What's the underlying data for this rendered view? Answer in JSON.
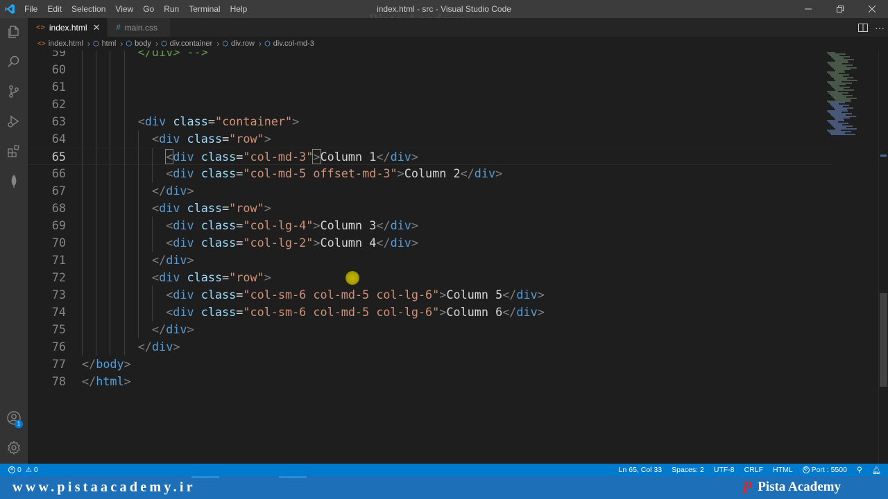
{
  "window": {
    "title": "index.html - src - Visual Studio Code",
    "watermark": "Pista Academy"
  },
  "menu": [
    "File",
    "Edit",
    "Selection",
    "View",
    "Go",
    "Run",
    "Terminal",
    "Help"
  ],
  "tabs": [
    {
      "label": "index.html",
      "icon": "html-file-icon",
      "active": true
    },
    {
      "label": "main.css",
      "icon": "css-file-icon",
      "active": false
    }
  ],
  "breadcrumb": [
    "index.html",
    "html",
    "body",
    "div.container",
    "div.row",
    "div.col-md-3"
  ],
  "editor": {
    "current_line": "65",
    "lines": [
      {
        "n": "59",
        "tokens": [
          [
            "c",
            "</div> -->"
          ]
        ],
        "indent": 4
      },
      {
        "n": "60",
        "tokens": [],
        "indent": 0
      },
      {
        "n": "61",
        "tokens": [],
        "indent": 0
      },
      {
        "n": "62",
        "tokens": [],
        "indent": 0
      },
      {
        "n": "63",
        "tokens": [
          [
            "b",
            "<"
          ],
          [
            "t",
            "div"
          ],
          [
            "x",
            " "
          ],
          [
            "a",
            "class"
          ],
          [
            "x",
            "="
          ],
          [
            "s",
            "\"container\""
          ],
          [
            "b",
            ">"
          ]
        ],
        "indent": 4
      },
      {
        "n": "64",
        "tokens": [
          [
            "b",
            "<"
          ],
          [
            "t",
            "div"
          ],
          [
            "x",
            " "
          ],
          [
            "a",
            "class"
          ],
          [
            "x",
            "="
          ],
          [
            "s",
            "\"row\""
          ],
          [
            "b",
            ">"
          ]
        ],
        "indent": 5
      },
      {
        "n": "65",
        "tokens": [
          [
            "b",
            "<"
          ],
          [
            "t",
            "div"
          ],
          [
            "x",
            " "
          ],
          [
            "a",
            "class"
          ],
          [
            "x",
            "="
          ],
          [
            "s",
            "\"col-md-3\""
          ],
          [
            "b",
            ">"
          ],
          [
            "x",
            "Column 1"
          ],
          [
            "b",
            "</"
          ],
          [
            "t",
            "div"
          ],
          [
            "b",
            ">"
          ]
        ],
        "indent": 6
      },
      {
        "n": "66",
        "tokens": [
          [
            "b",
            "<"
          ],
          [
            "t",
            "div"
          ],
          [
            "x",
            " "
          ],
          [
            "a",
            "class"
          ],
          [
            "x",
            "="
          ],
          [
            "s",
            "\"col-md-5 offset-md-3\""
          ],
          [
            "b",
            ">"
          ],
          [
            "x",
            "Column 2"
          ],
          [
            "b",
            "</"
          ],
          [
            "t",
            "div"
          ],
          [
            "b",
            ">"
          ]
        ],
        "indent": 6
      },
      {
        "n": "67",
        "tokens": [
          [
            "b",
            "</"
          ],
          [
            "t",
            "div"
          ],
          [
            "b",
            ">"
          ]
        ],
        "indent": 5
      },
      {
        "n": "68",
        "tokens": [
          [
            "b",
            "<"
          ],
          [
            "t",
            "div"
          ],
          [
            "x",
            " "
          ],
          [
            "a",
            "class"
          ],
          [
            "x",
            "="
          ],
          [
            "s",
            "\"row\""
          ],
          [
            "b",
            ">"
          ]
        ],
        "indent": 5
      },
      {
        "n": "69",
        "tokens": [
          [
            "b",
            "<"
          ],
          [
            "t",
            "div"
          ],
          [
            "x",
            " "
          ],
          [
            "a",
            "class"
          ],
          [
            "x",
            "="
          ],
          [
            "s",
            "\"col-lg-4\""
          ],
          [
            "b",
            ">"
          ],
          [
            "x",
            "Column 3"
          ],
          [
            "b",
            "</"
          ],
          [
            "t",
            "div"
          ],
          [
            "b",
            ">"
          ]
        ],
        "indent": 6
      },
      {
        "n": "70",
        "tokens": [
          [
            "b",
            "<"
          ],
          [
            "t",
            "div"
          ],
          [
            "x",
            " "
          ],
          [
            "a",
            "class"
          ],
          [
            "x",
            "="
          ],
          [
            "s",
            "\"col-lg-2\""
          ],
          [
            "b",
            ">"
          ],
          [
            "x",
            "Column 4"
          ],
          [
            "b",
            "</"
          ],
          [
            "t",
            "div"
          ],
          [
            "b",
            ">"
          ]
        ],
        "indent": 6
      },
      {
        "n": "71",
        "tokens": [
          [
            "b",
            "</"
          ],
          [
            "t",
            "div"
          ],
          [
            "b",
            ">"
          ]
        ],
        "indent": 5
      },
      {
        "n": "72",
        "tokens": [
          [
            "b",
            "<"
          ],
          [
            "t",
            "div"
          ],
          [
            "x",
            " "
          ],
          [
            "a",
            "class"
          ],
          [
            "x",
            "="
          ],
          [
            "s",
            "\"row\""
          ],
          [
            "b",
            ">"
          ]
        ],
        "indent": 5
      },
      {
        "n": "73",
        "tokens": [
          [
            "b",
            "<"
          ],
          [
            "t",
            "div"
          ],
          [
            "x",
            " "
          ],
          [
            "a",
            "class"
          ],
          [
            "x",
            "="
          ],
          [
            "s",
            "\"col-sm-6 col-md-5 col-lg-6\""
          ],
          [
            "b",
            ">"
          ],
          [
            "x",
            "Column 5"
          ],
          [
            "b",
            "</"
          ],
          [
            "t",
            "div"
          ],
          [
            "b",
            ">"
          ]
        ],
        "indent": 6
      },
      {
        "n": "74",
        "tokens": [
          [
            "b",
            "<"
          ],
          [
            "t",
            "div"
          ],
          [
            "x",
            " "
          ],
          [
            "a",
            "class"
          ],
          [
            "x",
            "="
          ],
          [
            "s",
            "\"col-sm-6 col-md-5 col-lg-6\""
          ],
          [
            "b",
            ">"
          ],
          [
            "x",
            "Column 6"
          ],
          [
            "b",
            "</"
          ],
          [
            "t",
            "div"
          ],
          [
            "b",
            ">"
          ]
        ],
        "indent": 6
      },
      {
        "n": "75",
        "tokens": [
          [
            "b",
            "</"
          ],
          [
            "t",
            "div"
          ],
          [
            "b",
            ">"
          ]
        ],
        "indent": 5
      },
      {
        "n": "76",
        "tokens": [
          [
            "b",
            "</"
          ],
          [
            "t",
            "div"
          ],
          [
            "b",
            ">"
          ]
        ],
        "indent": 4
      },
      {
        "n": "77",
        "tokens": [
          [
            "b",
            "</"
          ],
          [
            "t",
            "body"
          ],
          [
            "b",
            ">"
          ]
        ],
        "indent": 0
      },
      {
        "n": "78",
        "tokens": [
          [
            "b",
            "</"
          ],
          [
            "t",
            "html"
          ],
          [
            "b",
            ">"
          ]
        ],
        "indent": 0
      }
    ]
  },
  "statusbar": {
    "errors": "0",
    "warnings": "0",
    "position": "Ln 65, Col 33",
    "spaces": "Spaces: 2",
    "encoding": "UTF-8",
    "eol": "CRLF",
    "language": "HTML",
    "port": "Port : 5500"
  },
  "branding": {
    "url": "www.pistaacademy.ir",
    "name": "Pista Academy",
    "logo_letter": "P"
  },
  "activity": {
    "accounts_badge": "1"
  },
  "colors": {
    "accent": "#007acc",
    "brand_strip": "#1d6fb8",
    "keyword": "#569cd6",
    "attribute": "#9cdcfe",
    "string": "#ce9178",
    "comment": "#6a9955"
  }
}
